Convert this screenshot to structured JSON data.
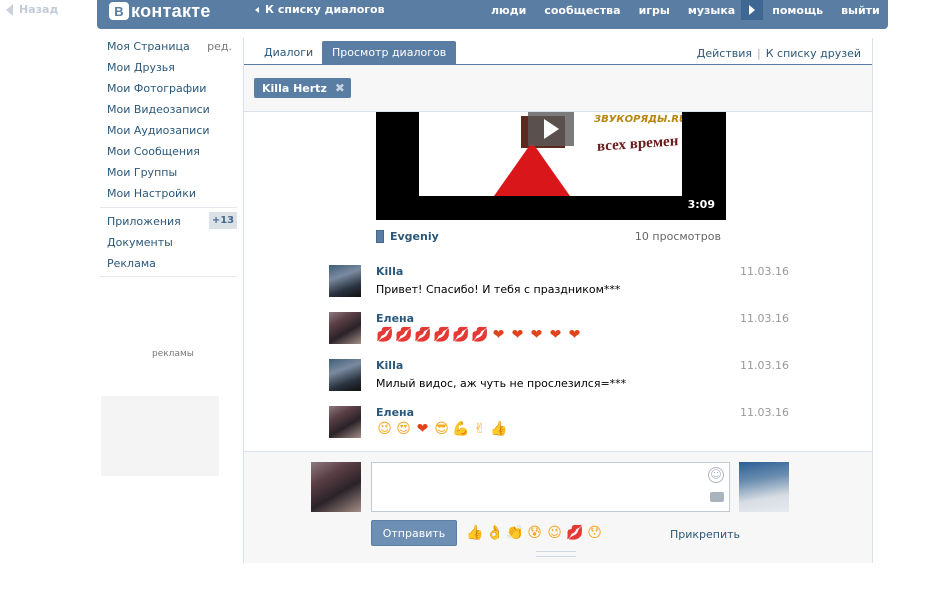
{
  "browser": {
    "back_label": "Назад"
  },
  "header": {
    "logo_badge": "В",
    "logo_text": "контакте",
    "back_to_dialogs": "К списку диалогов",
    "nav": [
      "люди",
      "сообщества",
      "игры",
      "музыка",
      "помощь",
      "выйти"
    ]
  },
  "left_menu": {
    "items": [
      "Моя Страница",
      "Мои Друзья",
      "Мои Фотографии",
      "Мои Видеозаписи",
      "Мои Аудиозаписи",
      "Мои Сообщения",
      "Мои Группы",
      "Мои Настройки"
    ],
    "edit_label": "ред.",
    "apps_label": "Приложения",
    "apps_count": "+13",
    "docs_label": "Документы",
    "ads_label": "Реклама",
    "ad_text": "рекламы"
  },
  "tabs": {
    "dialogs": "Диалоги",
    "view_dialogs": "Просмотр диалогов",
    "actions": "Действия",
    "sep": "|",
    "to_friends": "К списку друзей"
  },
  "peer": {
    "name": "Killa Hertz",
    "remove": "✖"
  },
  "video": {
    "duration": "3:09",
    "author": "Evgeniy",
    "views": "10 просмотров",
    "overlay_top": "ЗВУКОРЯДЫ.RU",
    "overlay_main": "всех времен"
  },
  "messages": [
    {
      "author": "Killa",
      "date": "11.03.16",
      "text": "Привет! Спасибо! И тебя с праздником***"
    },
    {
      "author": "Елена",
      "date": "11.03.16",
      "emoji": [
        "💋",
        "💋",
        "💋",
        "💋",
        "💋",
        "💋",
        "❤",
        "❤",
        "❤",
        "❤",
        "❤"
      ]
    },
    {
      "author": "Killa",
      "date": "11.03.16",
      "text": "Милый видос, аж чуть не прослезился=***"
    },
    {
      "author": "Елена",
      "date": "11.03.16",
      "emoji": [
        "😉",
        "😍",
        "❤",
        "😎",
        "💪",
        "✌",
        "👍"
      ]
    }
  ],
  "composer": {
    "placeholder": "",
    "send_label": "Отправить",
    "quick_emoji": [
      "👍",
      "👌",
      "👏",
      "😰",
      "😉",
      "💋",
      "😯"
    ],
    "attach_label": "Прикрепить",
    "smile_icon": "☺"
  },
  "colors": {
    "brand": "#597da3",
    "link": "#2b587a"
  }
}
